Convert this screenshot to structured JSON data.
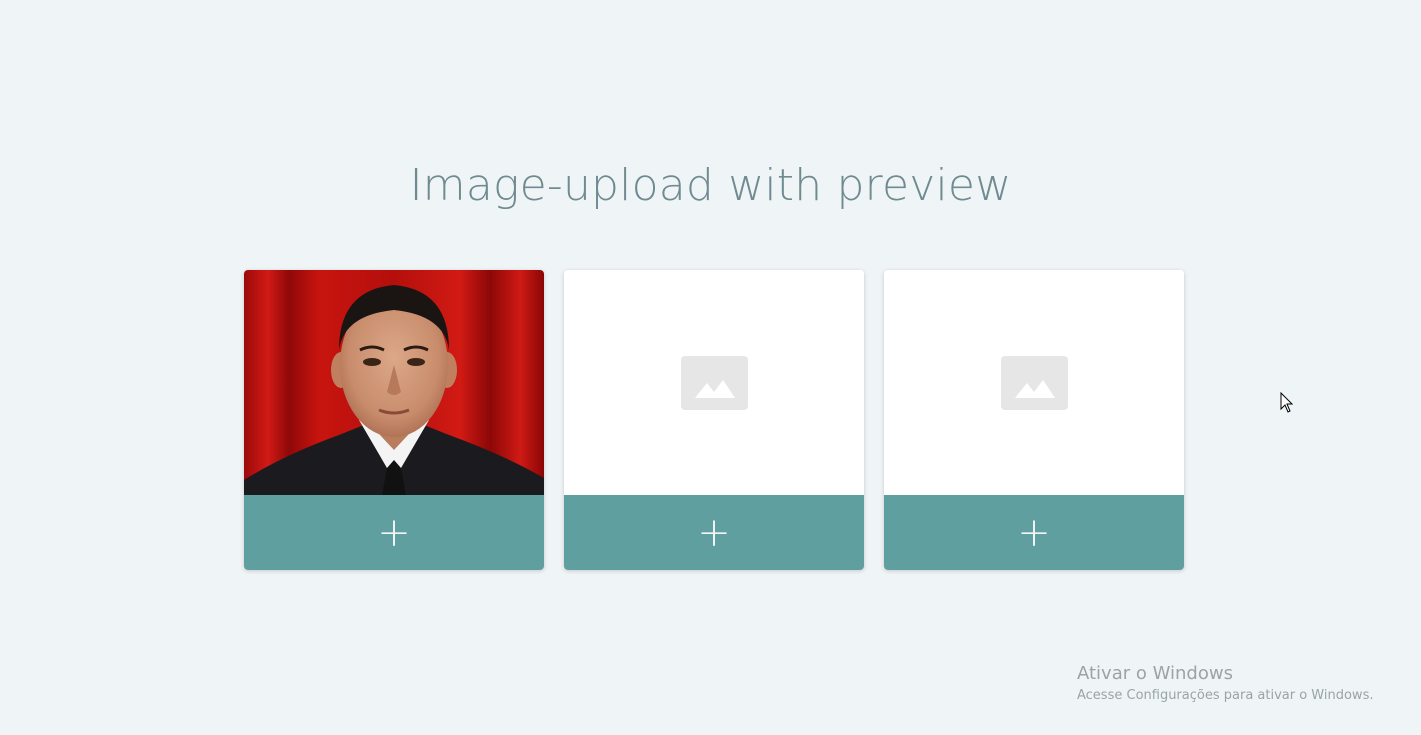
{
  "page": {
    "title": "Image-upload with preview"
  },
  "cards": [
    {
      "state": "photo-preview",
      "upload_label": "+"
    },
    {
      "state": "empty-placeholder",
      "upload_label": "+"
    },
    {
      "state": "empty-placeholder",
      "upload_label": "+"
    }
  ],
  "watermark": {
    "title": "Ativar o Windows",
    "subtitle": "Acesse Configurações para ativar o Windows."
  },
  "colors": {
    "background": "#eff4f6",
    "title": "#6f8a90",
    "upload_bar": "#609fa0",
    "placeholder": "#e6e6e6"
  },
  "icons": {
    "upload": "plus-icon",
    "placeholder": "image-placeholder-icon",
    "pointer": "mouse-cursor-icon"
  }
}
